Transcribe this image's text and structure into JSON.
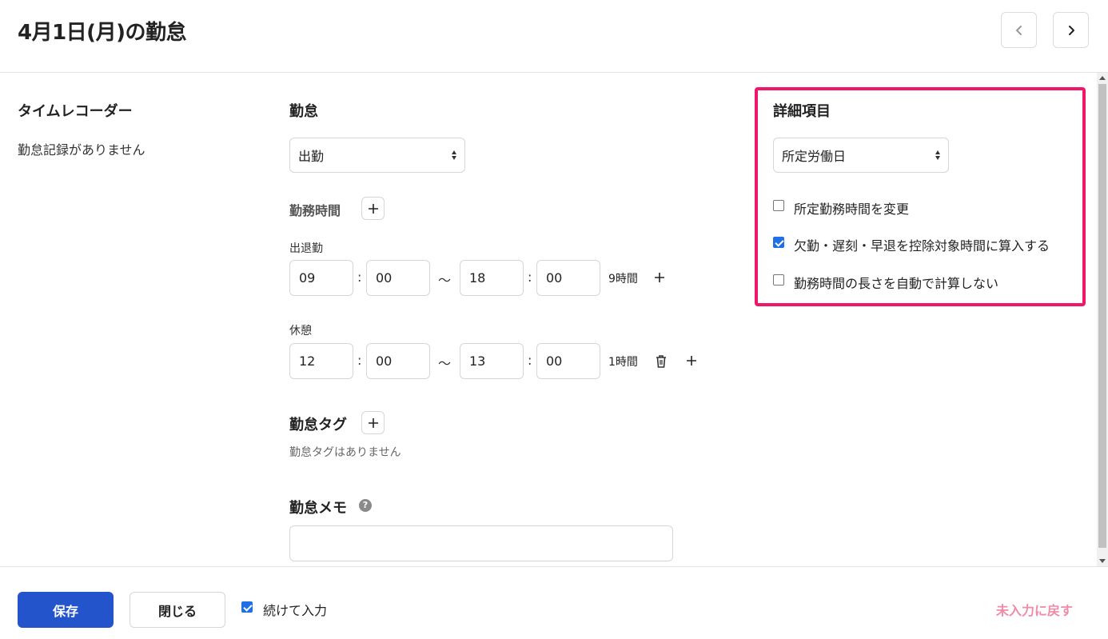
{
  "header": {
    "title": "4月1日(月)の勤怠",
    "prev_icon": "chevron-left-icon",
    "next_icon": "chevron-right-icon"
  },
  "time_recorder": {
    "heading": "タイムレコーダー",
    "empty_text": "勤怠記録がありません"
  },
  "attendance": {
    "heading": "勤怠",
    "type_selected": "出勤",
    "work_time_heading": "勤務時間",
    "shift": {
      "label": "出退勤",
      "start_hour": "09",
      "start_minute": "00",
      "end_hour": "18",
      "end_minute": "00",
      "duration": "9時間"
    },
    "break": {
      "label": "休憩",
      "start_hour": "12",
      "start_minute": "00",
      "end_hour": "13",
      "end_minute": "00",
      "duration": "1時間"
    },
    "colon": ":",
    "tilde": "〜"
  },
  "tags": {
    "heading": "勤怠タグ",
    "empty_text": "勤怠タグはありません"
  },
  "memo": {
    "heading": "勤怠メモ",
    "help_glyph": "?",
    "value": ""
  },
  "details": {
    "heading": "詳細項目",
    "day_type_selected": "所定労働日",
    "options": [
      {
        "label": "所定勤務時間を変更",
        "checked": false
      },
      {
        "label": "欠勤・遅刻・早退を控除対象時間に算入する",
        "checked": true
      },
      {
        "label": "勤務時間の長さを自動で計算しない",
        "checked": false
      }
    ],
    "highlight_color": "#f0166a"
  },
  "footer": {
    "save_label": "保存",
    "close_label": "閉じる",
    "continue_label": "続けて入力",
    "continue_checked": true,
    "revert_label": "未入力に戻す"
  },
  "colors": {
    "primary": "#2454cc",
    "checkbox": "#1f6fe5",
    "revert_link": "#f08aa6"
  }
}
